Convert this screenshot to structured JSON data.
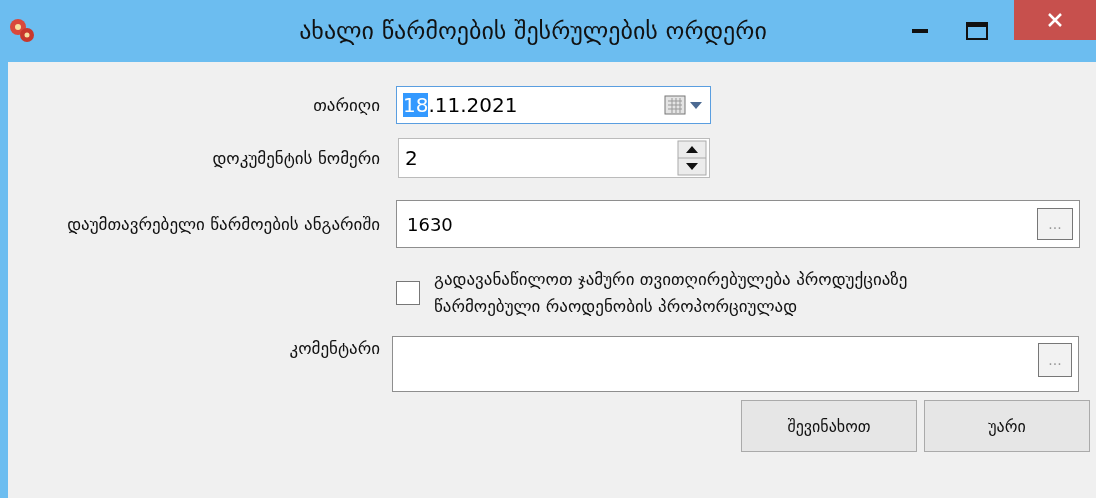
{
  "window": {
    "title": "ახალი წარმოების შესრულების ორდერი"
  },
  "fields": [
    {
      "kind": "date",
      "label": "თარიღი",
      "selected_part": "18",
      "rest": ".11.2021"
    },
    {
      "kind": "spin",
      "label": "დოკუმენტის ნომერი",
      "value": "2"
    },
    {
      "kind": "browse",
      "label": "დაუმთავრებელი წარმოების ანგარიში",
      "value": "1630",
      "button": "..."
    },
    {
      "kind": "checkbox",
      "label": "გადავანაწილოთ ჯამური თვითღირებულება პროდუქციაზე წარმოებული რაოდენობის პროპორციულად",
      "checked": false
    },
    {
      "kind": "memo",
      "label": "კომენტარი",
      "button": "..."
    }
  ],
  "buttons": [
    "შევინახოთ",
    "უარი"
  ]
}
